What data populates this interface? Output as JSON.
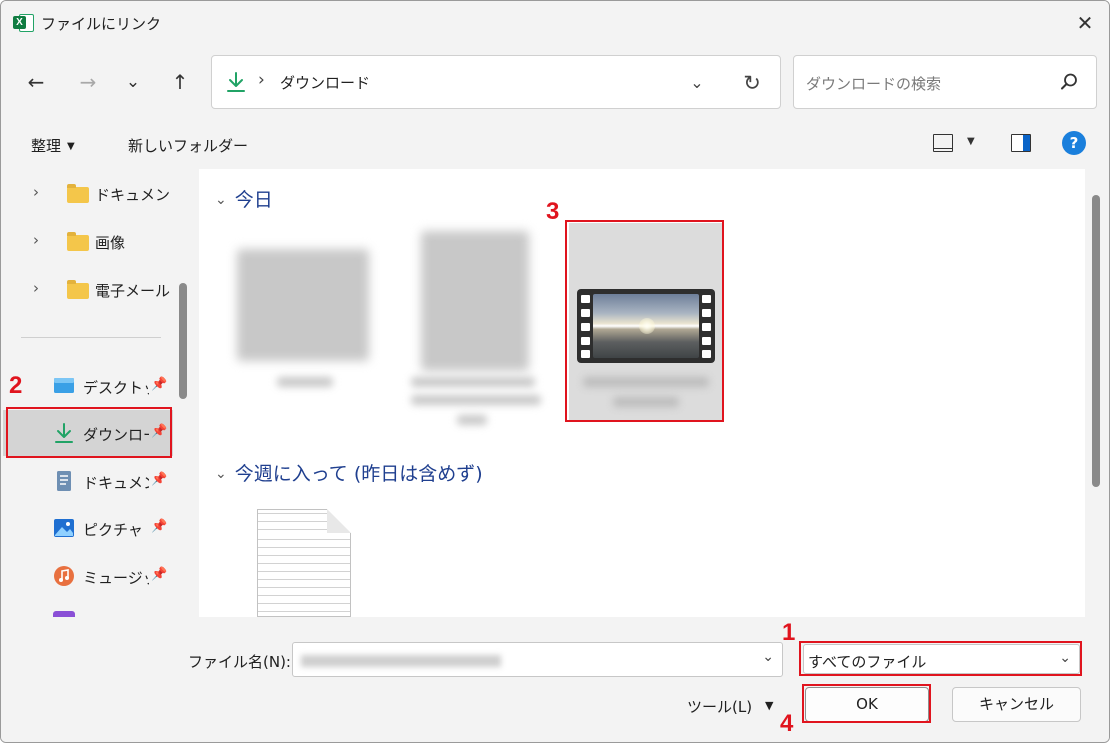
{
  "window": {
    "title": "ファイルにリンク",
    "app_icon": "excel-icon",
    "close_glyph": "✕"
  },
  "nav": {
    "back_glyph": "←",
    "forward_glyph": "→",
    "recent_glyph": "⌄",
    "up_glyph": "↑",
    "breadcrumb_sep": "›",
    "path": "ダウンロード",
    "address_dropdown_glyph": "⌄",
    "refresh_glyph": "↻",
    "search_placeholder": "ダウンロードの検索"
  },
  "commands": {
    "organize": "整理",
    "new_folder": "新しいフォルダー",
    "help": "?"
  },
  "sidebar": {
    "tree": [
      {
        "label": "ドキュメント"
      },
      {
        "label": "画像"
      },
      {
        "label": "電子メール"
      }
    ],
    "quick_access": [
      {
        "label": "デスクトップ",
        "icon": "desktop-icon",
        "pinned": true
      },
      {
        "label": "ダウンロード",
        "icon": "download-icon",
        "pinned": true,
        "selected": true
      },
      {
        "label": "ドキュメント",
        "icon": "document-icon",
        "pinned": true
      },
      {
        "label": "ピクチャ",
        "icon": "picture-icon",
        "pinned": true
      },
      {
        "label": "ミュージック",
        "icon": "music-icon",
        "pinned": true
      }
    ]
  },
  "content": {
    "groups": [
      {
        "label": "今日"
      },
      {
        "label": "今週に入って (昨日は含めず)"
      }
    ]
  },
  "footer": {
    "filename_label": "ファイル名(N):",
    "filetype_value": "すべてのファイル",
    "tools_label": "ツール(L)",
    "ok_label": "OK",
    "cancel_label": "キャンセル"
  },
  "annotations": [
    {
      "number": "1",
      "target": "file-type-select"
    },
    {
      "number": "2",
      "target": "sidebar-item-downloads"
    },
    {
      "number": "3",
      "target": "video-file-thumbnail"
    },
    {
      "number": "4",
      "target": "ok-button"
    }
  ],
  "colors": {
    "annotation_red": "#e0141e",
    "accent_blue": "#1a7fdc",
    "group_header": "#1f3f8f",
    "download_green": "#21a366"
  }
}
